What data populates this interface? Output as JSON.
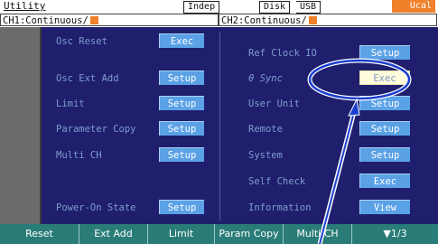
{
  "header": {
    "title": "Utility",
    "mode": "Indep",
    "storage": [
      "Disk",
      "USB"
    ],
    "cal_badge": "Ucal",
    "ch1_status": "CH1:Continuous/",
    "ch2_status": "CH2:Continuous/"
  },
  "left_menu": [
    {
      "label": "Osc Reset",
      "button": "Exec"
    },
    {
      "label": "Osc Ext Add",
      "button": "Setup"
    },
    {
      "label": "Limit",
      "button": "Setup"
    },
    {
      "label": "Parameter Copy",
      "button": "Setup"
    },
    {
      "label": "Multi CH",
      "button": "Setup"
    },
    {
      "label": "Power-On State",
      "button": "Setup"
    }
  ],
  "right_menu": [
    {
      "label": "Ref Clock IO",
      "button": "Setup"
    },
    {
      "label": "θ Sync",
      "button": "Exec",
      "highlighted": true
    },
    {
      "label": "User Unit",
      "button": "Setup"
    },
    {
      "label": "Remote",
      "button": "Setup"
    },
    {
      "label": "System",
      "button": "Setup"
    },
    {
      "label": "Self Check",
      "button": "Exec"
    },
    {
      "label": "Information",
      "button": "View"
    }
  ],
  "softkeys": [
    "Reset",
    "Ext Add",
    "Limit",
    "Param Copy",
    "Multi CH",
    "▼1/3"
  ],
  "colors": {
    "panel_bg": "#1f1f6e",
    "label_text": "#7f9ccc",
    "button_bg": "#5aa1e6",
    "softkey_bg": "#2a7c78",
    "accent_orange": "#f0802a",
    "annotation_blue": "#1a3fd0"
  }
}
